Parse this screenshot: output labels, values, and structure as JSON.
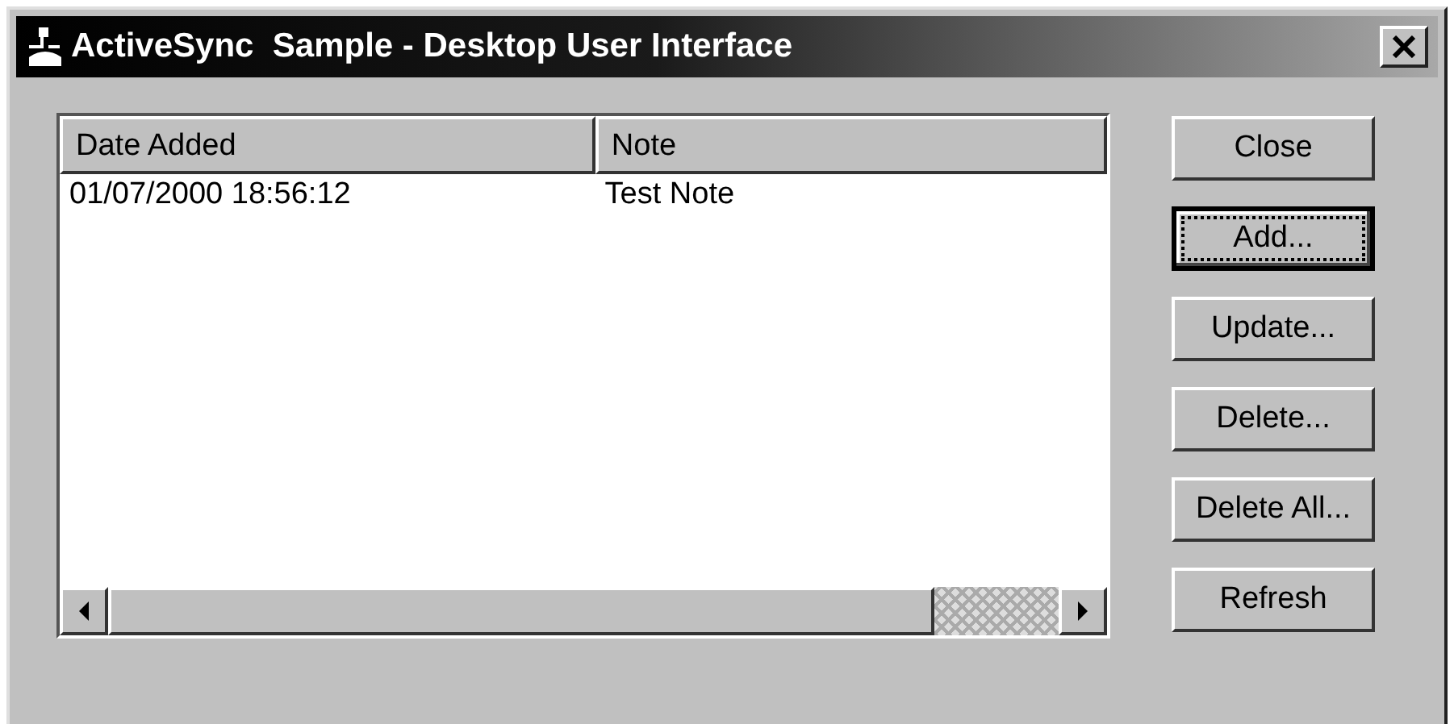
{
  "window": {
    "title": "ActiveSync  Sample - Desktop User Interface"
  },
  "list": {
    "columns": [
      "Date Added",
      "Note"
    ],
    "rows": [
      [
        "01/07/2000 18:56:12",
        "Test Note"
      ]
    ]
  },
  "buttons": [
    {
      "label": "Close",
      "focused": false
    },
    {
      "label": "Add...",
      "focused": true
    },
    {
      "label": "Update...",
      "focused": false
    },
    {
      "label": "Delete...",
      "focused": false
    },
    {
      "label": "Delete All...",
      "focused": false
    },
    {
      "label": "Refresh",
      "focused": false
    }
  ]
}
